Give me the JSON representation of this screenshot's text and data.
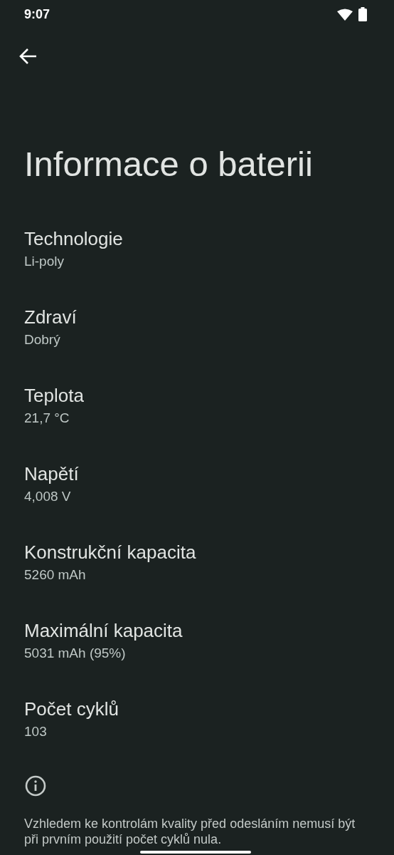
{
  "status_bar": {
    "time": "9:07"
  },
  "title": "Informace o baterii",
  "items": [
    {
      "label": "Technologie",
      "value": "Li-poly"
    },
    {
      "label": "Zdraví",
      "value": "Dobrý"
    },
    {
      "label": "Teplota",
      "value": "21,7 °C"
    },
    {
      "label": "Napětí",
      "value": "4,008 V"
    },
    {
      "label": "Konstrukční kapacita",
      "value": "5260 mAh"
    },
    {
      "label": "Maximální kapacita",
      "value": "5031 mAh (95%)"
    },
    {
      "label": "Počet cyklů",
      "value": "103"
    }
  ],
  "footer_note": "Vzhledem ke kontrolám kvality před odesláním nemusí být při prvním použití počet cyklů nula."
}
